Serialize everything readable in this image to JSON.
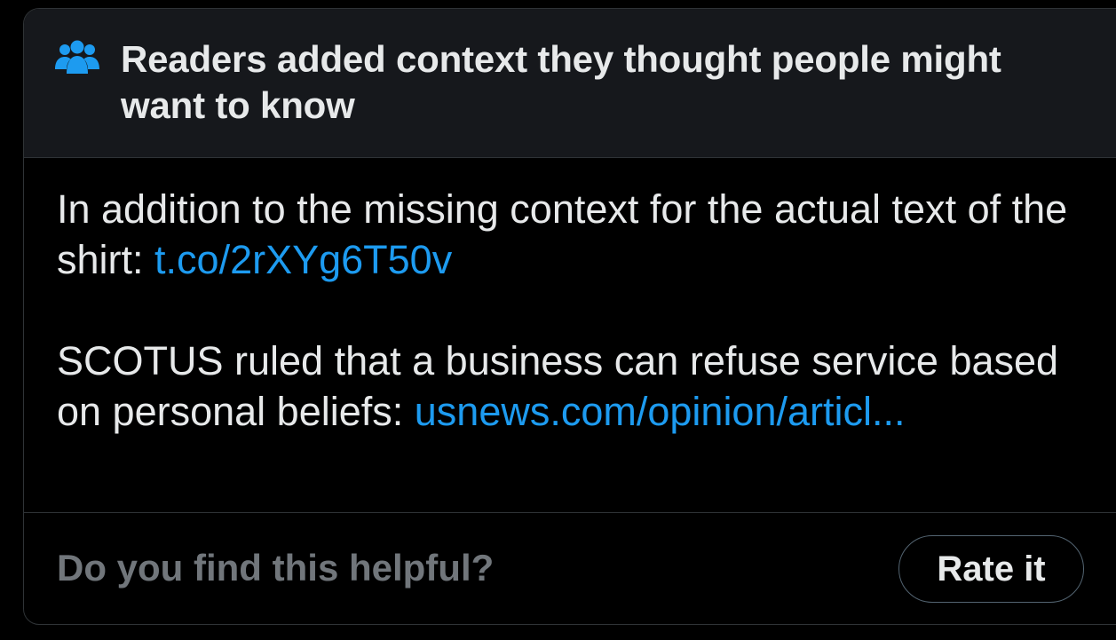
{
  "note": {
    "header": {
      "icon": "people-group-icon",
      "title": "Readers added context they thought people might want to know"
    },
    "body": {
      "paragraph1_text": "In addition to the missing context for the actual text of the shirt: ",
      "paragraph1_link": "t.co/2rXYg6T50v",
      "paragraph2_text": "SCOTUS ruled that a business can refuse service based on personal beliefs: ",
      "paragraph2_link": "usnews.com/opinion/articl..."
    },
    "footer": {
      "question": "Do you find this helpful?",
      "rate_label": "Rate it"
    }
  },
  "colors": {
    "background": "#000000",
    "header_background": "#16181c",
    "text_primary": "#e7e9ea",
    "text_secondary": "#71767b",
    "link": "#1d9bf0",
    "border": "#2f3336"
  }
}
